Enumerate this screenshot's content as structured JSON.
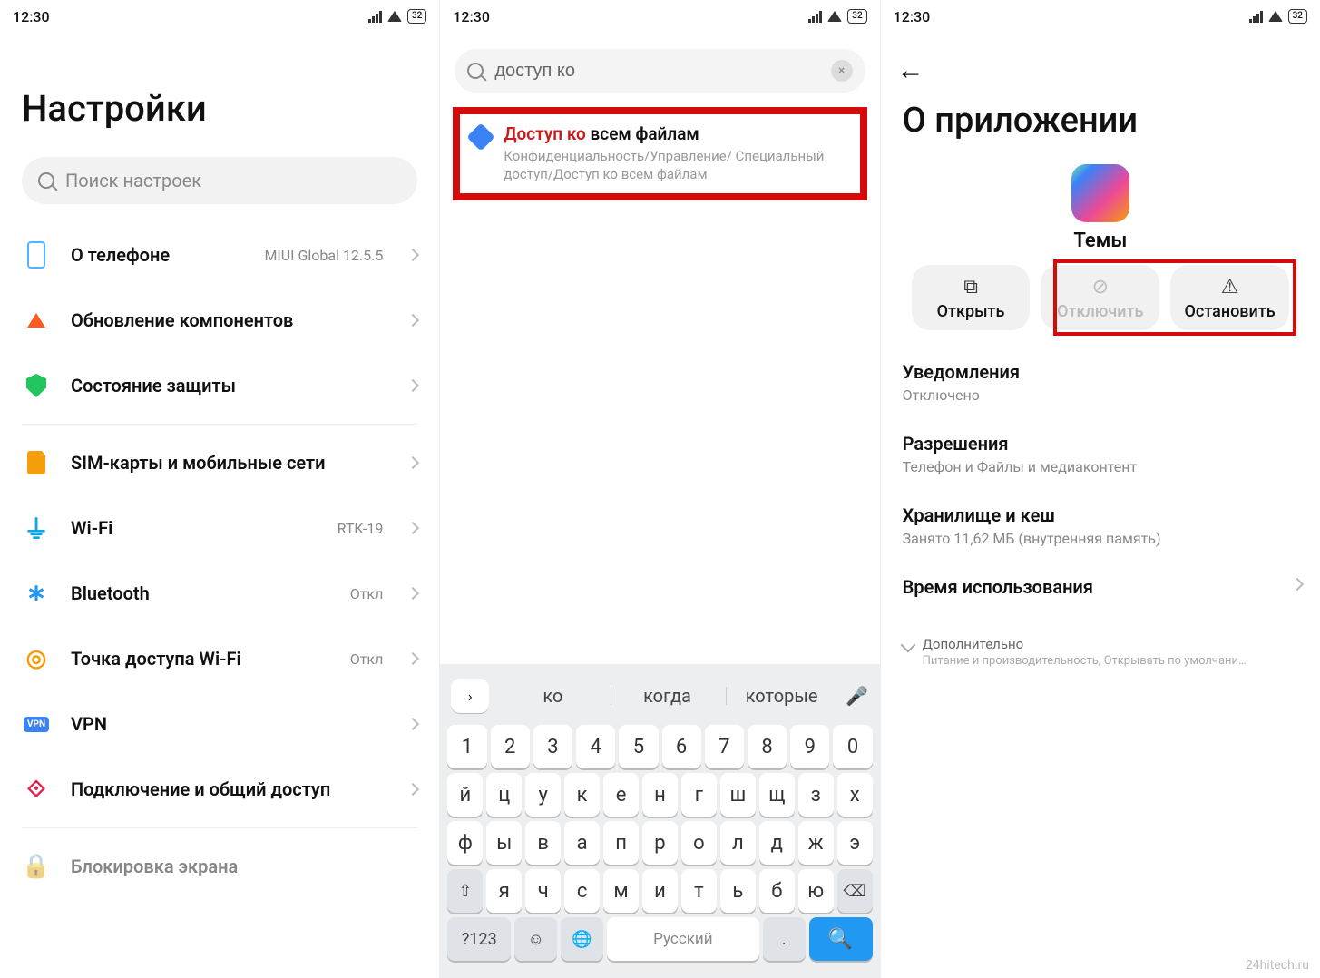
{
  "status": {
    "time": "12:30",
    "battery": "32"
  },
  "watermark": "24hitech.ru",
  "screen1": {
    "title": "Настройки",
    "search_placeholder": "Поиск настроек",
    "items": [
      {
        "icon": "phone-icon",
        "label": "О телефоне",
        "sub": "MIUI Global 12.5.5"
      },
      {
        "icon": "update-icon",
        "label": "Обновление компонентов",
        "sub": ""
      },
      {
        "icon": "shield-icon",
        "label": "Состояние защиты",
        "sub": ""
      },
      {
        "icon": "sim-icon",
        "label": "SIM-карты и мобильные сети",
        "sub": ""
      },
      {
        "icon": "wifi-icon",
        "label": "Wi-Fi",
        "sub": "RTK-19"
      },
      {
        "icon": "bluetooth-icon",
        "label": "Bluetooth",
        "sub": "Откл"
      },
      {
        "icon": "hotspot-icon",
        "label": "Точка доступа Wi-Fi",
        "sub": "Откл"
      },
      {
        "icon": "vpn-icon",
        "label": "VPN",
        "sub": ""
      },
      {
        "icon": "share-icon",
        "label": "Подключение и общий доступ",
        "sub": ""
      },
      {
        "icon": "lock-icon",
        "label": "Блокировка экрана",
        "sub": ""
      }
    ]
  },
  "screen2": {
    "search_value": "доступ ко",
    "clear": "×",
    "result": {
      "title_hl": "Доступ ко",
      "title_rest": " всем файлам",
      "path": "Конфиденциальность/Управление/ Специальный доступ/Доступ ко всем файлам"
    },
    "suggestions": [
      "ко",
      "когда",
      "которые"
    ],
    "keys_row1": [
      "1",
      "2",
      "3",
      "4",
      "5",
      "6",
      "7",
      "8",
      "9",
      "0"
    ],
    "keys_row2": [
      "й",
      "ц",
      "у",
      "к",
      "е",
      "н",
      "г",
      "ш",
      "щ",
      "з",
      "х"
    ],
    "keys_row3": [
      "ф",
      "ы",
      "в",
      "а",
      "п",
      "р",
      "о",
      "л",
      "д",
      "ж",
      "э"
    ],
    "keys_row4_shift": "⇧",
    "keys_row4": [
      "я",
      "ч",
      "с",
      "м",
      "и",
      "т",
      "ь",
      "б",
      "ю"
    ],
    "keys_row4_del": "⌫",
    "bottom": {
      "num": "?123",
      "emoji": "☺",
      "globe": "🌐",
      "space": "Русский",
      "dot": ".",
      "search_glyph": "🔍"
    }
  },
  "screen3": {
    "title": "О приложении",
    "app_name": "Темы",
    "actions": {
      "open": "Открыть",
      "disable": "Отключить",
      "stop": "Остановить"
    },
    "info": [
      {
        "title": "Уведомления",
        "desc": "Отключено",
        "chev": false
      },
      {
        "title": "Разрешения",
        "desc": "Телефон и Файлы и медиаконтент",
        "chev": false
      },
      {
        "title": "Хранилище и кеш",
        "desc": "Занято 11,62 МБ (внутренняя память)",
        "chev": false
      },
      {
        "title": "Время использования",
        "desc": "",
        "chev": true
      }
    ],
    "more": {
      "title": "Дополнительно",
      "desc": "Питание и производительность, Открывать по умолчани…"
    }
  }
}
